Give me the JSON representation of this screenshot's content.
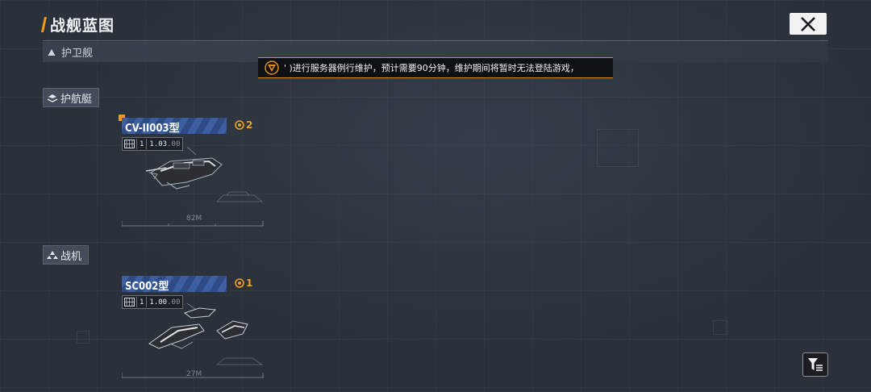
{
  "header": {
    "title": "战舰蓝图",
    "close_icon": "close-x-icon"
  },
  "section": {
    "label": "护卫舰",
    "icon": "triangle-up-icon"
  },
  "notice": {
    "icon": "warning-triangle-icon",
    "text": "' )进行服务器例行维护，预计需要90分钟，维护期间将暂时无法登陆游戏，",
    "border_color": "#e08a1d"
  },
  "categories": [
    {
      "label": "护航艇",
      "icon": "escort-boat-icon"
    },
    {
      "label": "战机",
      "icon": "fighter-icon"
    }
  ],
  "cards": [
    {
      "name": "CV-II003型",
      "count": "2",
      "tier": "1",
      "version": "1.03",
      "version_suffix": ".00",
      "size_label": "82M",
      "icon": "blueprint-token-icon"
    },
    {
      "name": "SC002型",
      "count": "1",
      "tier": "1",
      "version": "1.00",
      "version_suffix": ".00",
      "size_label": "27M",
      "icon": "blueprint-token-icon"
    }
  ],
  "filter": {
    "icon": "filter-icon"
  },
  "colors": {
    "accent": "#f39a1e",
    "name_band": "#3d5fa2",
    "count": "#f0a020"
  }
}
